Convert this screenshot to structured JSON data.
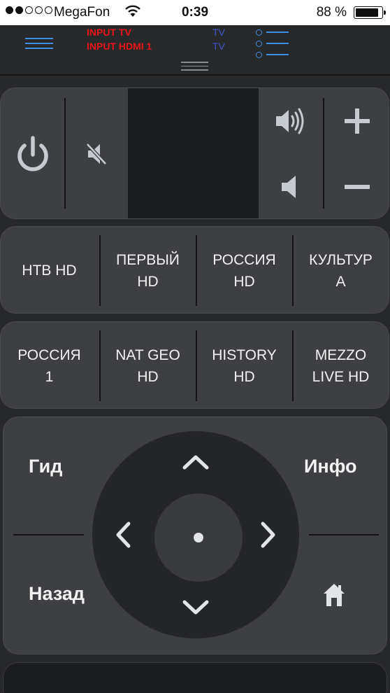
{
  "status_bar": {
    "carrier": "MegaFon",
    "time": "0:39",
    "battery_percent": "88 %",
    "battery_level": 0.88,
    "signal_bars_filled": 2,
    "signal_bars_total": 5
  },
  "header": {
    "inputs": [
      "INPUT TV",
      "INPUT HDMI 1"
    ],
    "sources": [
      "TV",
      "TV"
    ],
    "menu_icon": "hamburger-icon",
    "list_icon": "list-icon"
  },
  "volume_panel": {
    "power_icon": "power-icon",
    "mute_icon": "mute-icon",
    "volume_up_icon": "speaker-loud-icon",
    "volume_down_icon": "speaker-quiet-icon",
    "plus_icon": "plus-icon",
    "minus_icon": "minus-icon"
  },
  "channels": {
    "row1": [
      "НТВ HD",
      "ПЕРВЫЙ\nHD",
      "РОССИЯ\nHD",
      "КУЛЬТУР\nА"
    ],
    "row2": [
      "РОССИЯ\n1",
      "NAT GEO\nHD",
      "HISTORY\nHD",
      "MEZZO\nLIVE HD"
    ]
  },
  "navigation": {
    "guide_label": "Гид",
    "info_label": "Инфо",
    "back_label": "Назад",
    "home_icon": "home-icon",
    "center_icon": "ok-dot-icon"
  },
  "colors": {
    "accent_blue": "#3e8fe0",
    "input_red": "#e8141b",
    "source_blue": "#3e55c8",
    "panel": "#3e3f42",
    "background": "#27282a"
  }
}
